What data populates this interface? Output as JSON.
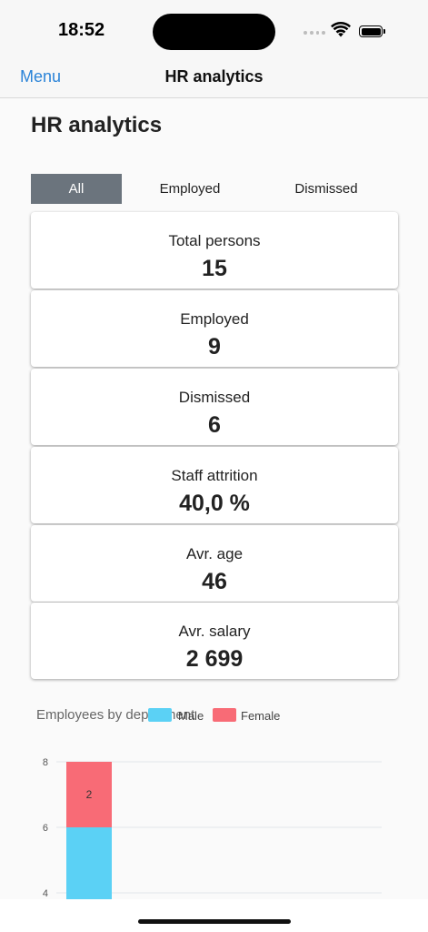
{
  "status": {
    "time": "18:52"
  },
  "nav": {
    "menu_label": "Menu",
    "title": "HR analytics"
  },
  "page": {
    "title": "HR analytics"
  },
  "filter": {
    "tabs": [
      "All",
      "Employed",
      "Dismissed"
    ],
    "selected": "All"
  },
  "stats": [
    {
      "label": "Total persons",
      "value": "15"
    },
    {
      "label": "Employed",
      "value": "9"
    },
    {
      "label": "Dismissed",
      "value": "6"
    },
    {
      "label": "Staff attrition",
      "value": "40,0 %"
    },
    {
      "label": "Avr. age",
      "value": "46"
    },
    {
      "label": "Avr. salary",
      "value": "2 699"
    }
  ],
  "chart": {
    "title": "Employees by department",
    "legend": [
      {
        "name": "Male",
        "color": "#5bd1f5"
      },
      {
        "name": "Female",
        "color": "#f86b76"
      }
    ]
  },
  "chart_data": {
    "type": "bar",
    "stacked": true,
    "title": "Employees by department",
    "y_ticks": [
      4,
      6,
      8
    ],
    "categories": [
      ""
    ],
    "series": [
      {
        "name": "Male",
        "color": "#5bd1f5",
        "values": [
          6
        ]
      },
      {
        "name": "Female",
        "color": "#f86b76",
        "values": [
          2
        ]
      }
    ],
    "data_labels": [
      "2"
    ]
  }
}
